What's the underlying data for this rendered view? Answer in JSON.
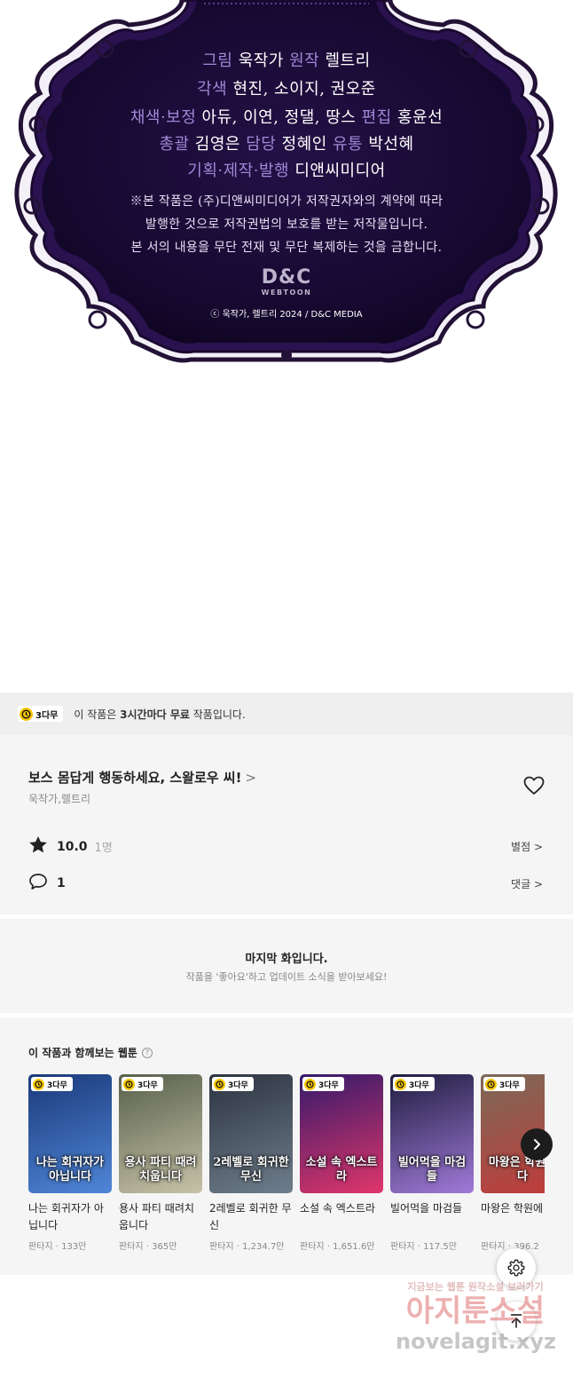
{
  "credits": {
    "lines": [
      {
        "role1": "그림",
        "name1": "욱작가",
        "role2": "원작",
        "name2": "렐트리"
      },
      {
        "role1": "각색",
        "name1": "현진, 소이지, 권오준",
        "role2": "",
        "name2": ""
      },
      {
        "role1": "채색·보정",
        "name1": "아듀, 이연, 정댈, 땅스",
        "role2": "편집",
        "name2": "홍윤선"
      },
      {
        "role1": "총괄",
        "name1": "김영은",
        "role2": "담당",
        "name2": "정혜인",
        "role3": "유통",
        "name3": "박선혜"
      },
      {
        "role1": "기획·제작·발행",
        "name1": "디앤씨미디어",
        "role2": "",
        "name2": ""
      }
    ],
    "notice": [
      "※본 작품은 (주)디앤씨미디어가 저작권자와의 계약에 따라",
      "발행한 것으로 저작권법의 보호를 받는 저작물입니다.",
      "본 서의 내용을 무단 전재 및 무단 복제하는 것을 금합니다."
    ],
    "logo_main": "D&C",
    "logo_sub": "WEBTOON",
    "copyright": "ⓒ 욱작가, 렐트리 2024 / D&C MEDIA"
  },
  "free_banner": {
    "badge": "3다무",
    "text_pre": "이 작품은 ",
    "text_bold": "3시간마다 무료",
    "text_post": " 작품입니다."
  },
  "series": {
    "title": "보스 몸답게 행동하세요, 스왈로우 씨!",
    "title_chevron": ">",
    "author": "욱작가,렐트리",
    "rating": "10.0",
    "rating_count": "1명",
    "rate_link": "별점 >",
    "comment_count": "1",
    "comment_link": "댓글 >"
  },
  "last_episode": {
    "title": "마지막 화입니다.",
    "subtitle": "작품을 '좋아요'하고 업데이트 소식을 받아보세요!"
  },
  "recommendations": {
    "title": "이 작품과 함께보는 웹툰",
    "help": "?",
    "items": [
      {
        "badge": "3다무",
        "name": "나는 회귀자가 아닙니다",
        "meta": "판타지 · 133만",
        "thumb_text": "나는 회귀자가 아닙니다",
        "colors": [
          "#1b3a7a",
          "#4f86d8"
        ]
      },
      {
        "badge": "3다무",
        "name": "용사 파티 때려치웁니다",
        "meta": "판타지 · 365만",
        "thumb_text": "용사 파티 때려치웁니다",
        "colors": [
          "#57604a",
          "#c7c2a8"
        ]
      },
      {
        "badge": "3다무",
        "name": "2레벨로 회귀한 무신",
        "meta": "판타지 · 1,234.7만",
        "thumb_text": "2레벨로 회귀한 무신",
        "colors": [
          "#2c3440",
          "#6f7d8c"
        ]
      },
      {
        "badge": "3다무",
        "name": "소설 속 엑스트라",
        "meta": "판타지 · 1,651.6만",
        "thumb_text": "소설 속 엑스트라",
        "colors": [
          "#341a6b",
          "#e0366a"
        ]
      },
      {
        "badge": "3다무",
        "name": "빌어먹을 마검들",
        "meta": "판타지 · 117.5만",
        "thumb_text": "빌어먹을 마검들",
        "colors": [
          "#1f1d3f",
          "#a07ad8"
        ]
      },
      {
        "badge": "3다무",
        "name": "마왕은 학원에 다",
        "meta": "판타지 · 396.2",
        "thumb_text": "마왕은 학원에 다",
        "colors": [
          "#7b6a58",
          "#c23a3a"
        ]
      }
    ]
  },
  "watermark": {
    "line1": "지금보는 웹툰 원작소설 보러가기",
    "line2": "아지툰소설",
    "line3": "novelagit.xyz"
  },
  "icons": {
    "star": "star-icon",
    "comment": "comment-bubble-icon",
    "heart": "heart-outline-icon",
    "settings": "gear-icon",
    "top": "arrow-up-icon",
    "next": "chevron-right-icon"
  },
  "colors": {
    "panel_bg": "#1c0d3a",
    "role_text": "#9f88d6",
    "badge_yellow": "#f7c600",
    "card_bg": "#f5f5f5",
    "banner_bg": "#efefef"
  }
}
